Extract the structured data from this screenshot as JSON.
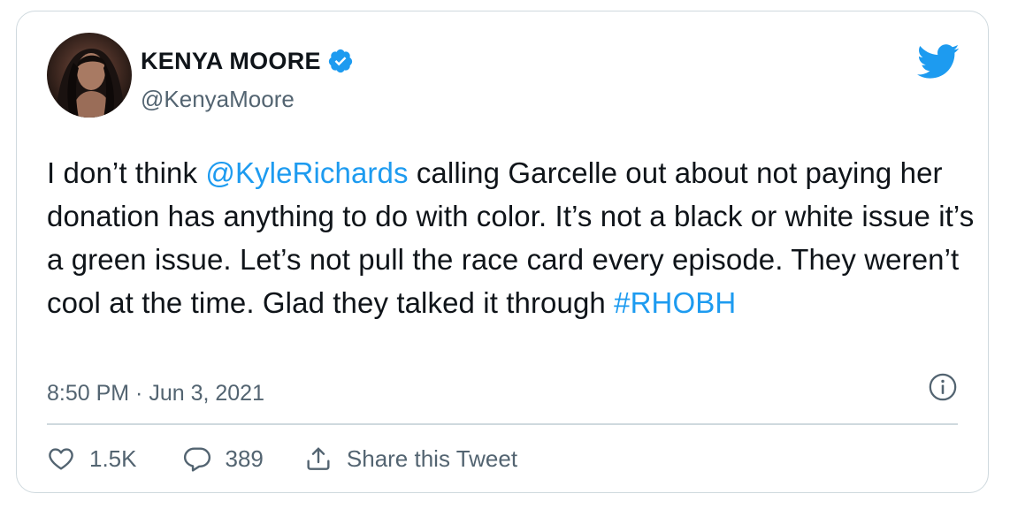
{
  "author": {
    "display_name": "KENYA MOORE",
    "handle": "@KenyaMoore",
    "verified": true
  },
  "tweet": {
    "text_segments": [
      {
        "type": "text",
        "text": "I don’t think "
      },
      {
        "type": "link",
        "text": "@KyleRichards"
      },
      {
        "type": "text",
        "text": " calling Garcelle out about not paying her donation has anything to do with color. It’s not a black or white issue it’s a green issue. Let’s not pull the race card every episode. They weren’t cool at the time. Glad they talked it through "
      },
      {
        "type": "link",
        "text": "#RHOBH"
      }
    ],
    "timestamp": "8:50 PM · Jun 3, 2021"
  },
  "actions": {
    "like_count": "1.5K",
    "reply_count": "389",
    "share_label": "Share this Tweet"
  },
  "colors": {
    "accent": "#1d9bf0",
    "text": "#0f1419",
    "secondary_text": "#536471",
    "border": "#cfd9de"
  },
  "icons": [
    "verified-badge-icon",
    "twitter-bird-icon",
    "info-icon",
    "heart-icon",
    "reply-icon",
    "share-icon"
  ]
}
